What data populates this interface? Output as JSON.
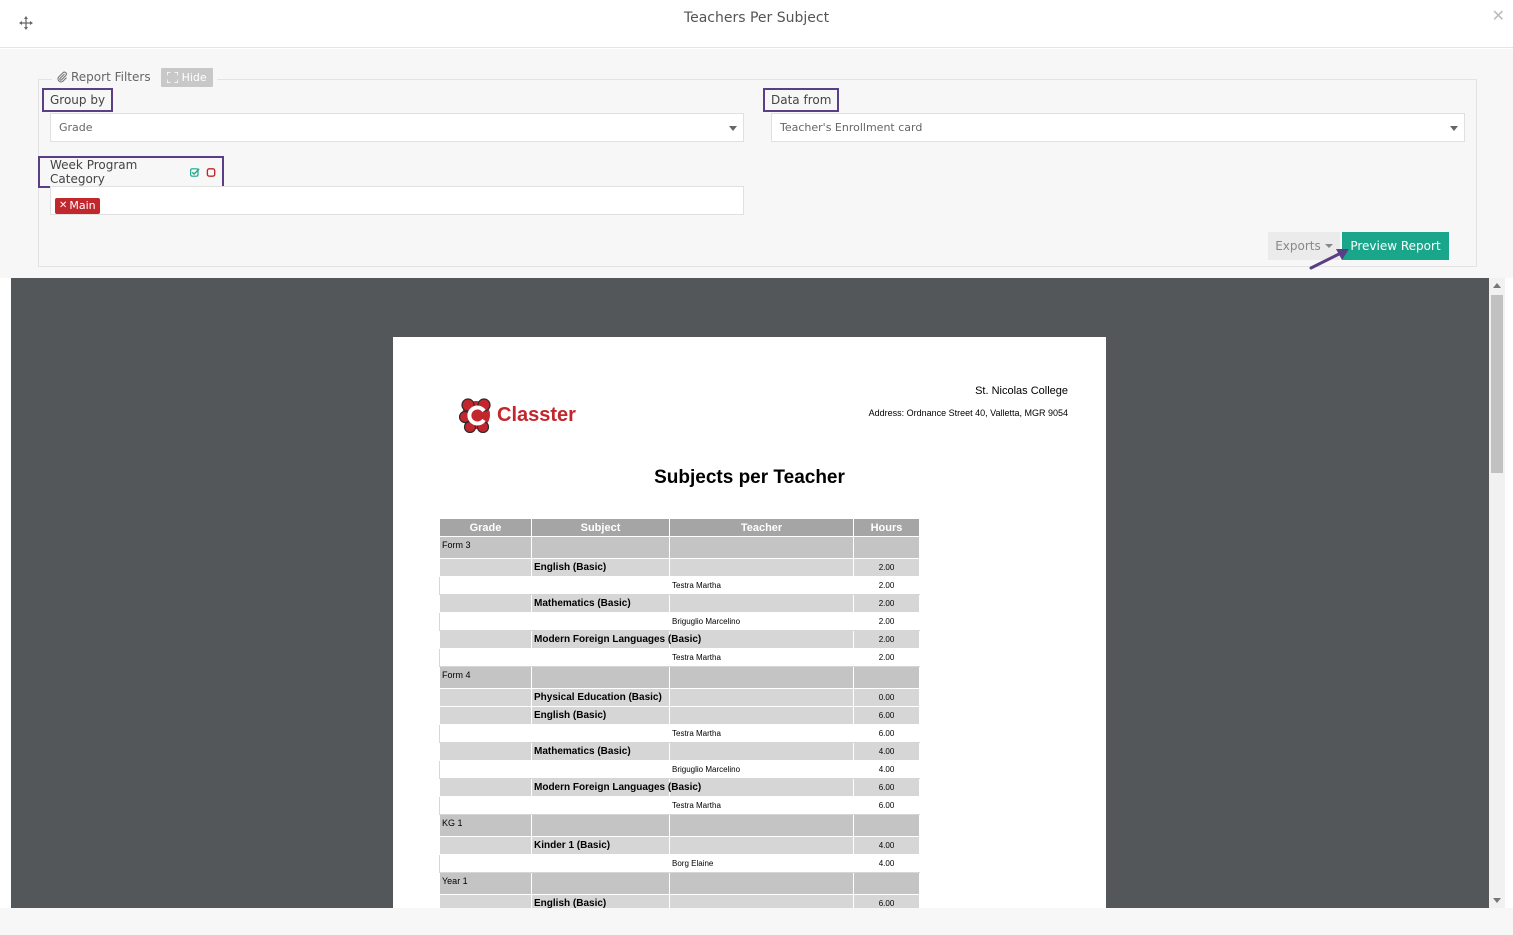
{
  "window": {
    "title": "Teachers Per Subject"
  },
  "filters": {
    "legend_label": "Report Filters",
    "hide_label": "Hide",
    "group_by": {
      "label": "Group by",
      "value": "Grade"
    },
    "data_from": {
      "label": "Data from",
      "value": "Teacher's Enrollment card"
    },
    "week_program_category": {
      "label": "Week Program Category",
      "tags": [
        "Main"
      ]
    }
  },
  "actions": {
    "exports_label": "Exports",
    "preview_label": "Preview Report"
  },
  "colors": {
    "accent": "#1aa68a",
    "annotation": "#5b3f86",
    "tag": "#c1272d",
    "viewer_bg": "#53575a"
  },
  "report": {
    "logo_text": "Classter",
    "school_name": "St. Nicolas College",
    "address": "Address: Ordnance Street 40, Valletta, MGR 9054",
    "title": "Subjects per Teacher",
    "columns": [
      "Grade",
      "Subject",
      "Teacher",
      "Hours"
    ],
    "rows": [
      {
        "type": "grade",
        "grade": "Form 3"
      },
      {
        "type": "subject",
        "subject": "English (Basic)",
        "hours": "2.00"
      },
      {
        "type": "teacher",
        "teacher": "Testra Martha",
        "hours": "2.00"
      },
      {
        "type": "subject",
        "subject": "Mathematics (Basic)",
        "hours": "2.00"
      },
      {
        "type": "teacher",
        "teacher": "Briguglio Marcelino",
        "hours": "2.00"
      },
      {
        "type": "subject",
        "subject": "Modern Foreign Languages (Basic)",
        "hours": "2.00"
      },
      {
        "type": "teacher",
        "teacher": "Testra Martha",
        "hours": "2.00"
      },
      {
        "type": "grade",
        "grade": "Form 4"
      },
      {
        "type": "subject",
        "subject": "Physical Education (Basic)",
        "hours": "0.00"
      },
      {
        "type": "subject",
        "subject": "English (Basic)",
        "hours": "6.00"
      },
      {
        "type": "teacher",
        "teacher": "Testra Martha",
        "hours": "6.00"
      },
      {
        "type": "subject",
        "subject": "Mathematics (Basic)",
        "hours": "4.00"
      },
      {
        "type": "teacher",
        "teacher": "Briguglio Marcelino",
        "hours": "4.00"
      },
      {
        "type": "subject",
        "subject": "Modern Foreign Languages (Basic)",
        "hours": "6.00"
      },
      {
        "type": "teacher",
        "teacher": "Testra Martha",
        "hours": "6.00"
      },
      {
        "type": "grade",
        "grade": "KG 1"
      },
      {
        "type": "subject",
        "subject": "Kinder 1 (Basic)",
        "hours": "4.00"
      },
      {
        "type": "teacher",
        "teacher": "Borg Elaine",
        "hours": "4.00"
      },
      {
        "type": "grade",
        "grade": "Year 1"
      },
      {
        "type": "subject",
        "subject": "English (Basic)",
        "hours": "6.00"
      }
    ]
  }
}
